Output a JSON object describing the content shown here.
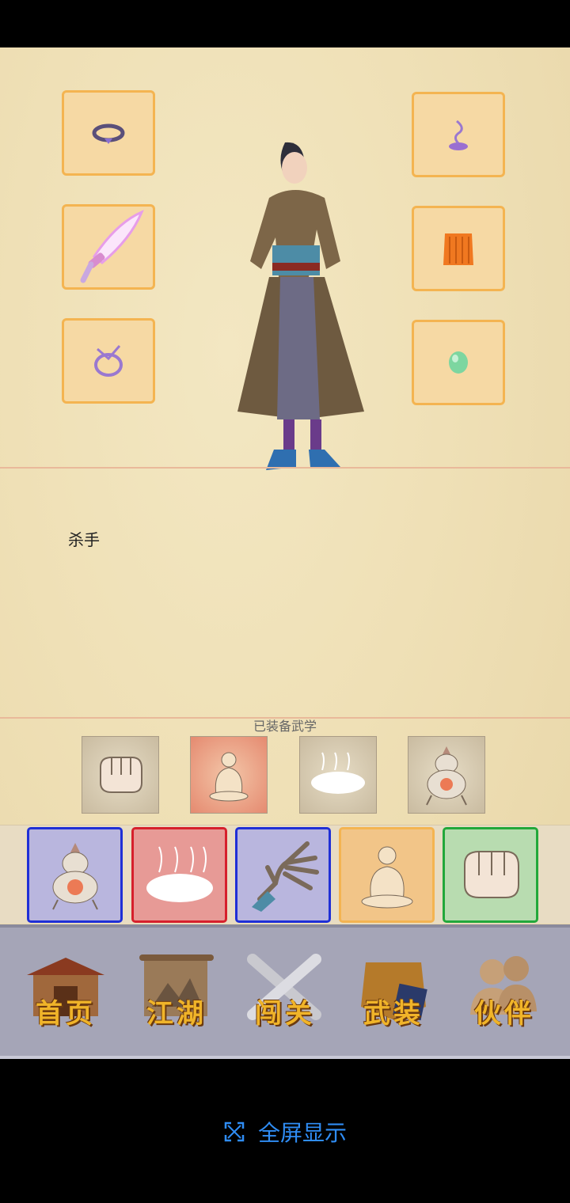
{
  "character": {
    "role": "杀手"
  },
  "equipment": {
    "left": [
      "ring-icon",
      "sword-icon",
      "bracelet-icon"
    ],
    "right": [
      "incense-icon",
      "robe-icon",
      "jade-icon"
    ]
  },
  "skills": {
    "title": "已装备武学",
    "equipped": [
      "fist-icon",
      "meditation-icon",
      "mist-icon",
      "furnace-icon"
    ],
    "pool": [
      {
        "icon": "furnace-icon",
        "border": "#1f2fd6",
        "bg": "#b9b6de"
      },
      {
        "icon": "mist-icon",
        "border": "#d6202c",
        "bg": "#e79a96"
      },
      {
        "icon": "palm-icon",
        "border": "#1f2fd6",
        "bg": "#b9b6de"
      },
      {
        "icon": "meditation-icon",
        "border": "#f4b451",
        "bg": "#f2c588"
      },
      {
        "icon": "fist-icon",
        "border": "#22a83a",
        "bg": "#b8dcb0"
      }
    ]
  },
  "nav": {
    "home": "首页",
    "jianghu": "江湖",
    "challenge": "闯关",
    "armory": "武装",
    "partner": "伙伴"
  },
  "fullscreen": {
    "label": "全屏显示"
  }
}
